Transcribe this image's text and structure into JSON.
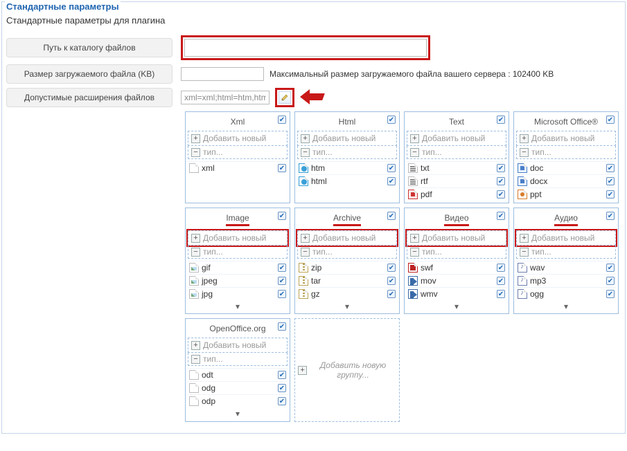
{
  "panel": {
    "legend": "Стандартные параметры",
    "subtitle": "Стандартные параметры для плагина"
  },
  "rows": {
    "path_label": "Путь к каталогу файлов",
    "path_value": "",
    "size_label": "Размер загружаемого файла (KB)",
    "size_value": "",
    "size_hint": "Максимальный размер загружаемого файла вашего сервера : 102400 KB",
    "ext_label": "Допустимые расширения файлов",
    "ext_value": "xml=xml;html=htm,html;t"
  },
  "common": {
    "add_new": "Добавить новый",
    "type": "тип...",
    "add_group": "Добавить новую группу..."
  },
  "groups": {
    "xml": {
      "title": "Xml",
      "items": [
        "xml"
      ]
    },
    "html": {
      "title": "Html",
      "items": [
        "htm",
        "html"
      ]
    },
    "text": {
      "title": "Text",
      "items": [
        "txt",
        "rtf",
        "pdf"
      ]
    },
    "office": {
      "title": "Microsoft Office®",
      "items": [
        "doc",
        "docx",
        "ppt"
      ]
    },
    "image": {
      "title": "Image",
      "items": [
        "gif",
        "jpeg",
        "jpg"
      ]
    },
    "archive": {
      "title": "Archive",
      "items": [
        "zip",
        "tar",
        "gz"
      ]
    },
    "video": {
      "title": "Видео",
      "items": [
        "swf",
        "mov",
        "wmv"
      ]
    },
    "audio": {
      "title": "Аудио",
      "items": [
        "wav",
        "mp3",
        "ogg"
      ]
    },
    "oo": {
      "title": "OpenOffice.org",
      "items": [
        "odt",
        "odg",
        "odp"
      ]
    }
  }
}
